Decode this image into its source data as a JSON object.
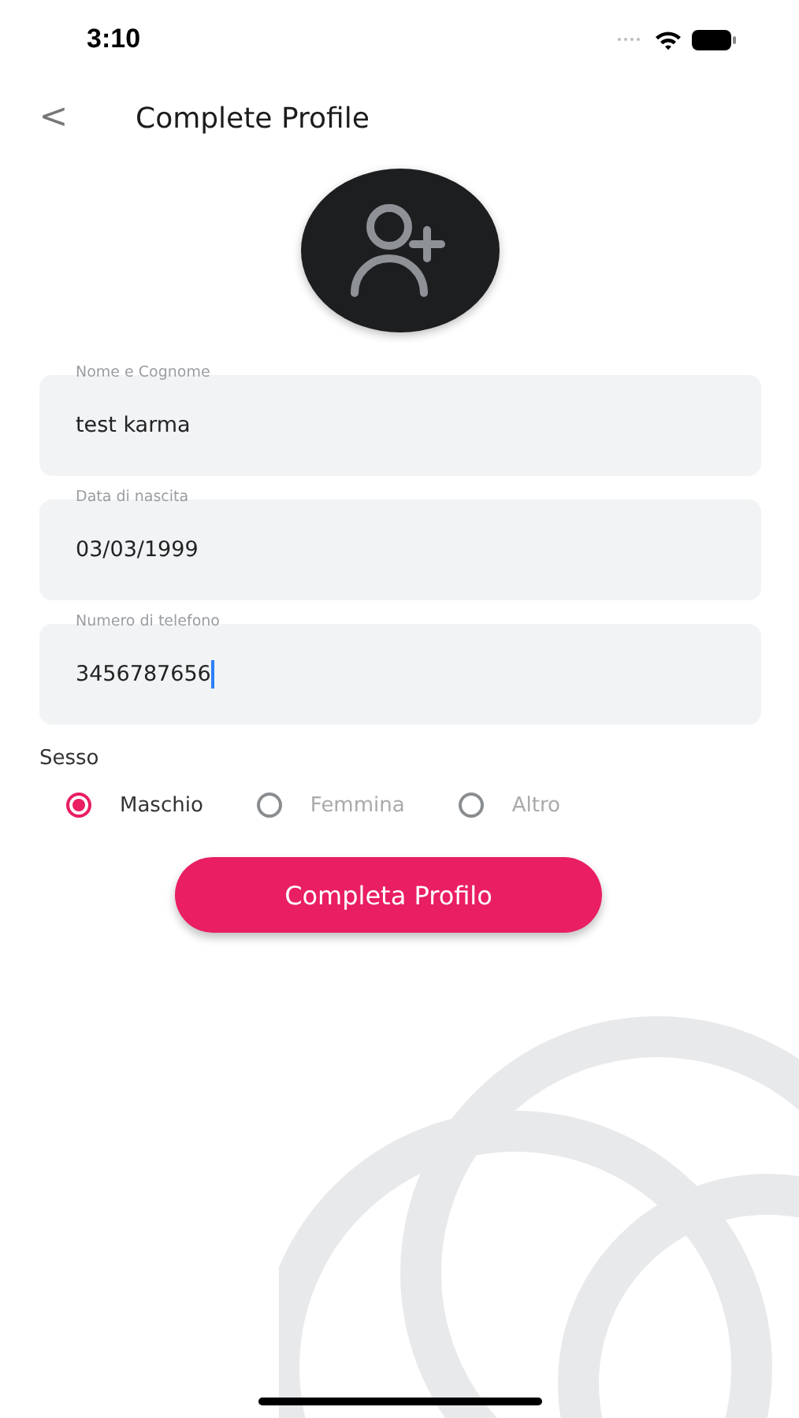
{
  "status_bar": {
    "time": "3:10"
  },
  "header": {
    "back": "<",
    "title": "Complete Profile"
  },
  "fields": [
    {
      "label": "Nome e Cognome",
      "value": "test karma",
      "focused": false
    },
    {
      "label": "Data di nascita",
      "value": "03/03/1999",
      "focused": false
    },
    {
      "label": "Numero di telefono",
      "value": "3456787656",
      "focused": true
    }
  ],
  "gender": {
    "label": "Sesso",
    "options": [
      {
        "label": "Maschio",
        "selected": true
      },
      {
        "label": "Femmina",
        "selected": false
      },
      {
        "label": "Altro",
        "selected": false
      }
    ]
  },
  "submit": {
    "label": "Completa Profilo"
  }
}
